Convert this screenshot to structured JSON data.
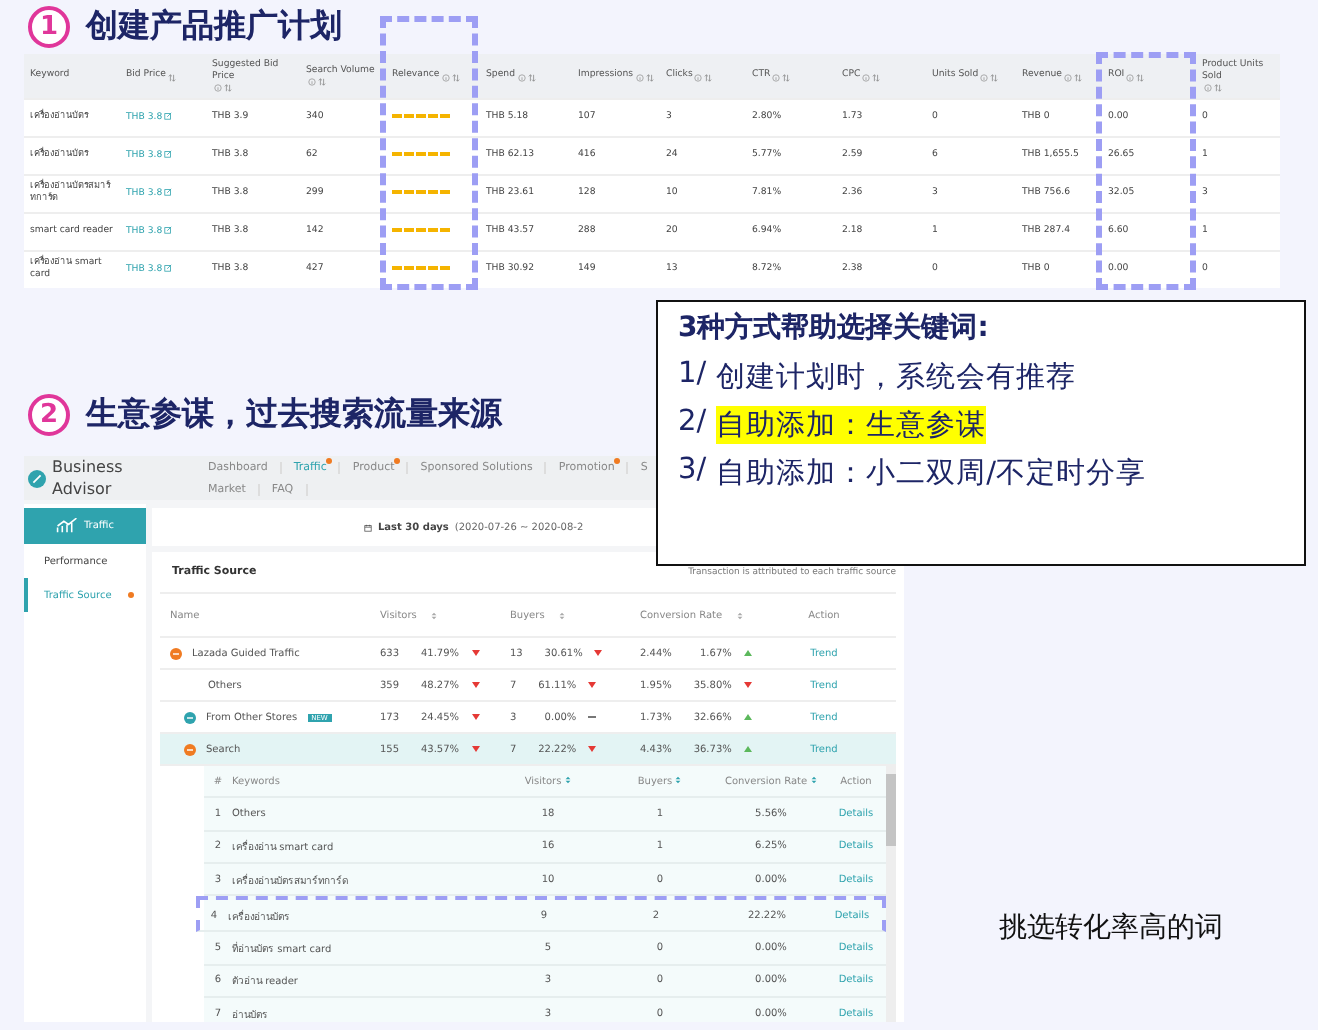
{
  "step1": {
    "number": "1",
    "title": "创建产品推广计划"
  },
  "keyword_table": {
    "columns": [
      {
        "label": "Keyword",
        "info": false,
        "sortable": false
      },
      {
        "label": "Bid Price",
        "info": false,
        "sortable": true
      },
      {
        "label": "Suggested Bid Price",
        "info": true,
        "sortable": true
      },
      {
        "label": "Search Volume",
        "info": true,
        "sortable": true
      },
      {
        "label": "Relevance",
        "info": true,
        "sortable": true
      },
      {
        "label": "Spend",
        "info": true,
        "sortable": true
      },
      {
        "label": "Impressions",
        "info": true,
        "sortable": true
      },
      {
        "label": "Clicks",
        "info": true,
        "sortable": true
      },
      {
        "label": "CTR",
        "info": true,
        "sortable": true
      },
      {
        "label": "CPC",
        "info": true,
        "sortable": true
      },
      {
        "label": "Units Sold",
        "info": true,
        "sortable": true
      },
      {
        "label": "Revenue",
        "info": true,
        "sortable": true
      },
      {
        "label": "ROI",
        "info": true,
        "sortable": true
      },
      {
        "label": "Product Units Sold",
        "info": true,
        "sortable": true
      }
    ],
    "rows": [
      {
        "keyword": "เครื่องอ่านบัตร",
        "bid_price": "THB 3.8",
        "suggested_bid": "THB 3.9",
        "search_volume": "340",
        "stars": 5,
        "spend": "THB 5.18",
        "impressions": "107",
        "clicks": "3",
        "ctr": "2.80%",
        "cpc": "1.73",
        "units_sold": "0",
        "revenue": "THB 0",
        "roi": "0.00",
        "product_units_sold": "0"
      },
      {
        "keyword": "เครื่องอ่านบัตร",
        "bid_price": "THB 3.8",
        "suggested_bid": "THB 3.8",
        "search_volume": "62",
        "stars": 5,
        "spend": "THB 62.13",
        "impressions": "416",
        "clicks": "24",
        "ctr": "5.77%",
        "cpc": "2.59",
        "units_sold": "6",
        "revenue": "THB 1,655.5",
        "roi": "26.65",
        "product_units_sold": "1"
      },
      {
        "keyword": "เครื่องอ่านบัตรสมาร์ทการ์ด",
        "bid_price": "THB 3.8",
        "suggested_bid": "THB 3.8",
        "search_volume": "299",
        "stars": 5,
        "spend": "THB 23.61",
        "impressions": "128",
        "clicks": "10",
        "ctr": "7.81%",
        "cpc": "2.36",
        "units_sold": "3",
        "revenue": "THB 756.6",
        "roi": "32.05",
        "product_units_sold": "3"
      },
      {
        "keyword": "smart card reader",
        "bid_price": "THB 3.8",
        "suggested_bid": "THB 3.8",
        "search_volume": "142",
        "stars": 5,
        "spend": "THB 43.57",
        "impressions": "288",
        "clicks": "20",
        "ctr": "6.94%",
        "cpc": "2.18",
        "units_sold": "1",
        "revenue": "THB 287.4",
        "roi": "6.60",
        "product_units_sold": "1"
      },
      {
        "keyword": "เครื่องอ่าน smart card",
        "bid_price": "THB 3.8",
        "suggested_bid": "THB 3.8",
        "search_volume": "427",
        "stars": 5,
        "spend": "THB 30.92",
        "impressions": "149",
        "clicks": "13",
        "ctr": "8.72%",
        "cpc": "2.38",
        "units_sold": "0",
        "revenue": "THB 0",
        "roi": "0.00",
        "product_units_sold": "0"
      }
    ]
  },
  "callout": {
    "title": "3种方式帮助选择关键词:",
    "lines": [
      {
        "prefix": "1/",
        "text": "创建计划时，系统会有推荐",
        "highlighted": false
      },
      {
        "prefix": "2/",
        "text": "自助添加：生意参谋",
        "highlighted": true
      },
      {
        "prefix": "3/",
        "text": "自助添加：小二双周/不定时分享",
        "highlighted": false
      }
    ]
  },
  "step2": {
    "number": "2",
    "title": "生意参谋，过去搜索流量来源"
  },
  "business_advisor": {
    "brand": "Business Advisor",
    "nav": [
      {
        "label": "Dashboard",
        "selected": false,
        "dot": false
      },
      {
        "label": "Traffic",
        "selected": true,
        "dot": true
      },
      {
        "label": "Product",
        "selected": false,
        "dot": true
      },
      {
        "label": "Sponsored Solutions",
        "selected": false,
        "dot": false
      },
      {
        "label": "Promotion",
        "selected": false,
        "dot": true
      },
      {
        "label": "S",
        "selected": false,
        "dot": false
      },
      {
        "label": "Market",
        "selected": false,
        "dot": false
      },
      {
        "label": "FAQ",
        "selected": false,
        "dot": false
      }
    ],
    "sidebar": {
      "section": "Traffic",
      "items": [
        {
          "label": "Performance",
          "selected": false,
          "dot": false
        },
        {
          "label": "Traffic Source",
          "selected": true,
          "dot": true
        }
      ]
    },
    "date": {
      "label": "Last 30 days",
      "range": "(2020-07-26 ~ 2020-08-2"
    },
    "panel": {
      "title": "Traffic Source",
      "note": "Transaction is attributed to each traffic source",
      "columns": [
        {
          "label": "Name",
          "sortable": false
        },
        {
          "label": "Visitors",
          "sortable": true
        },
        {
          "label": "Buyers",
          "sortable": true
        },
        {
          "label": "Conversion Rate",
          "sortable": true
        },
        {
          "label": "Action",
          "sortable": false
        }
      ],
      "rows": [
        {
          "kind": "group",
          "color": "#f07b22",
          "name": "Lazada Guided Traffic",
          "selected": false,
          "metrics": [
            {
              "value": "633",
              "change": "41.79%",
              "kind": "down"
            },
            {
              "value": "13",
              "change": "30.61%",
              "kind": "down"
            },
            {
              "value": "2.44%",
              "change": "1.67%",
              "kind": "up"
            }
          ],
          "action": "Trend"
        },
        {
          "kind": "child",
          "name": "Others",
          "selected": false,
          "metrics": [
            {
              "value": "359",
              "change": "48.27%",
              "kind": "down"
            },
            {
              "value": "7",
              "change": "61.11%",
              "kind": "down"
            },
            {
              "value": "1.95%",
              "change": "35.80%",
              "kind": "down"
            }
          ],
          "action": "Trend"
        },
        {
          "kind": "source",
          "color": "#2fa3ae",
          "name": "From Other Stores",
          "badge": "NEW",
          "selected": false,
          "metrics": [
            {
              "value": "173",
              "change": "24.45%",
              "kind": "down"
            },
            {
              "value": "3",
              "change": "0.00%",
              "kind": "flat"
            },
            {
              "value": "1.73%",
              "change": "32.66%",
              "kind": "up"
            }
          ],
          "action": "Trend"
        },
        {
          "kind": "source",
          "color": "#f07b22",
          "name": "Search",
          "selected": true,
          "metrics": [
            {
              "value": "155",
              "change": "43.57%",
              "kind": "down"
            },
            {
              "value": "7",
              "change": "22.22%",
              "kind": "down"
            },
            {
              "value": "4.43%",
              "change": "36.73%",
              "kind": "up"
            }
          ],
          "action": "Trend"
        }
      ],
      "keywords": {
        "columns": [
          {
            "label": "#",
            "sortable": false
          },
          {
            "label": "Keywords",
            "sortable": false
          },
          {
            "label": "Visitors",
            "sortable": true
          },
          {
            "label": "Buyers",
            "sortable": true
          },
          {
            "label": "Conversion Rate",
            "sortable": true
          },
          {
            "label": "Action",
            "sortable": false
          }
        ],
        "rows": [
          {
            "rank": "1",
            "highlighted": false,
            "keyword": "Others",
            "visitors": "18",
            "buyers": "1",
            "conversion": "5.56%",
            "action": "Details"
          },
          {
            "rank": "2",
            "highlighted": false,
            "keyword": "เครื่องอ่าน smart card",
            "visitors": "16",
            "buyers": "1",
            "conversion": "6.25%",
            "action": "Details"
          },
          {
            "rank": "3",
            "highlighted": false,
            "keyword": "เครื่องอ่านบัตรสมาร์ทการ์ด",
            "visitors": "10",
            "buyers": "0",
            "conversion": "0.00%",
            "action": "Details"
          },
          {
            "rank": "4",
            "highlighted": true,
            "keyword": "เครื่องอ่านบัตร",
            "visitors": "9",
            "buyers": "2",
            "conversion": "22.22%",
            "action": "Details"
          },
          {
            "rank": "5",
            "highlighted": false,
            "keyword": "ที่อ่านบัตร smart card",
            "visitors": "5",
            "buyers": "0",
            "conversion": "0.00%",
            "action": "Details"
          },
          {
            "rank": "6",
            "highlighted": false,
            "keyword": "ตัวอ่าน reader",
            "visitors": "3",
            "buyers": "0",
            "conversion": "0.00%",
            "action": "Details"
          },
          {
            "rank": "7",
            "highlighted": false,
            "keyword": "อ่านบัตร",
            "visitors": "3",
            "buyers": "0",
            "conversion": "0.00%",
            "action": "Details"
          }
        ]
      }
    }
  },
  "annotation": "挑选转化率高的词"
}
